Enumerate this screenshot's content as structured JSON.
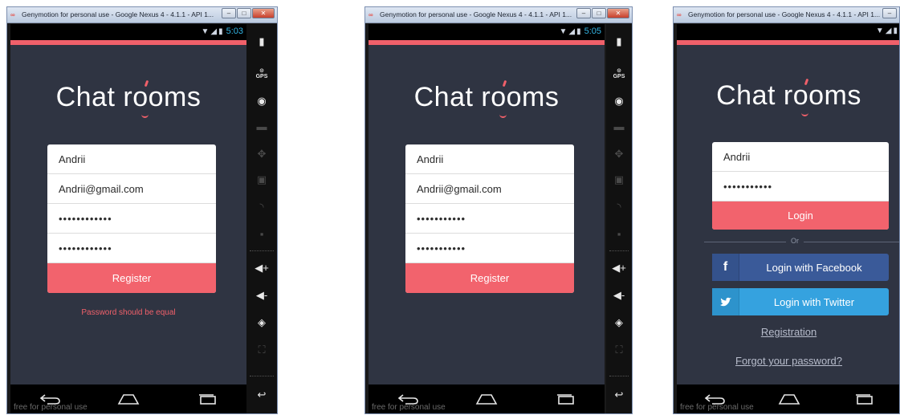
{
  "window_title": "Genymotion for personal use - Google Nexus 4 - 4.1.1 - API 1...",
  "watermark": "free for personal use",
  "app_name": "Chat rooms",
  "colors": {
    "accent": "#f0606a",
    "background": "#2f3442",
    "facebook": "#3a5a99",
    "twitter": "#35a2df"
  },
  "screen1": {
    "time": "5:03",
    "name_value": "Andrii",
    "email_value": "Andrii@gmail.com",
    "password_value": "••••••••••••",
    "confirm_value": "••••••••••••",
    "register_label": "Register",
    "error_text": "Password should be equal"
  },
  "screen2": {
    "time": "5:05",
    "name_value": "Andrii",
    "email_value": "Andrii@gmail.com",
    "password_value": "•••••••••••",
    "confirm_value": "•••••••••••",
    "register_label": "Register"
  },
  "screen3": {
    "name_value": "Andrii",
    "password_value": "•••••••••••",
    "login_label": "Login",
    "or_text": "Or",
    "facebook_label": "Login with Facebook",
    "twitter_label": "Login with Twitter",
    "registration_link": "Registration",
    "forgot_link": "Forgot your password?"
  },
  "sidebar_icons": [
    "battery-icon",
    "gps-icon",
    "camera-icon",
    "remote-control-icon",
    "dpad-icon",
    "id-icon",
    "rss-icon",
    "sms-icon",
    "volume-up-icon",
    "volume-down-icon",
    "rotate-icon",
    "resize-icon",
    "back-icon"
  ],
  "nav_icons": [
    "back-icon",
    "home-icon",
    "recent-apps-icon"
  ]
}
